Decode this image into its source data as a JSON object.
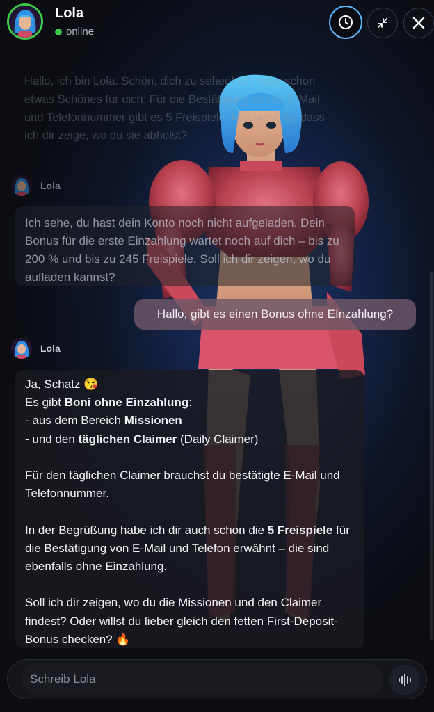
{
  "header": {
    "title": "Lola",
    "status": "online",
    "status_color": "#3ec84a"
  },
  "icons": {
    "history": "clock-icon",
    "minimize": "minimize-icon",
    "close": "close-icon",
    "voice": "voice-waveform-icon"
  },
  "accent_color": "#5ab9ff",
  "messages": {
    "faded": "Hallo, ich bin Lola. Schön, dich zu sehen! Ich habe schon etwas Schönes für dich: Für die Bestätigung deiner E-Mail und Telefonnummer gibt es 5 Freispiele. Möchtest du, dass ich dir zeige, wo du sie abholst?",
    "sender1": "Lola",
    "bot1": "Ich sehe, du hast dein Konto noch nicht aufgeladen. Dein Bonus für die erste Einzahlung wartet noch auf dich – bis zu 200 % und bis zu 245 Freispiele. Soll ich dir zeigen, wo du aufladen kannst?",
    "user1": "Hallo, gibt es einen Bonus ohne EInzahlung?",
    "sender2": "Lola",
    "bot2": {
      "greeting": "Ja, Schatz 😘",
      "line1_pre": "Es gibt ",
      "line1_bold": "Boni ohne Einzahlung",
      "line1_post": ":",
      "line2_pre": "- aus dem Bereich ",
      "line2_bold": "Missionen",
      "line3_pre": "- und den ",
      "line3_bold": "täglichen Claimer",
      "line3_post": " (Daily Claimer)",
      "para2": "Für den täglichen Claimer brauchst du bestätigte E-Mail und Telefonnummer.",
      "para3_pre": "In der Begrüßung habe ich dir auch schon die ",
      "para3_bold": "5 Freispiele",
      "para3_post": " für die Bestätigung von E-Mail und Telefon erwähnt – die sind ebenfalls ohne Einzahlung.",
      "para4": "Soll ich dir zeigen, wo du die Missionen und den Claimer findest? Oder willst du lieber gleich den fetten First-Deposit-Bonus checken? 🔥"
    }
  },
  "composer": {
    "placeholder": "Schreib Lola",
    "value": ""
  }
}
